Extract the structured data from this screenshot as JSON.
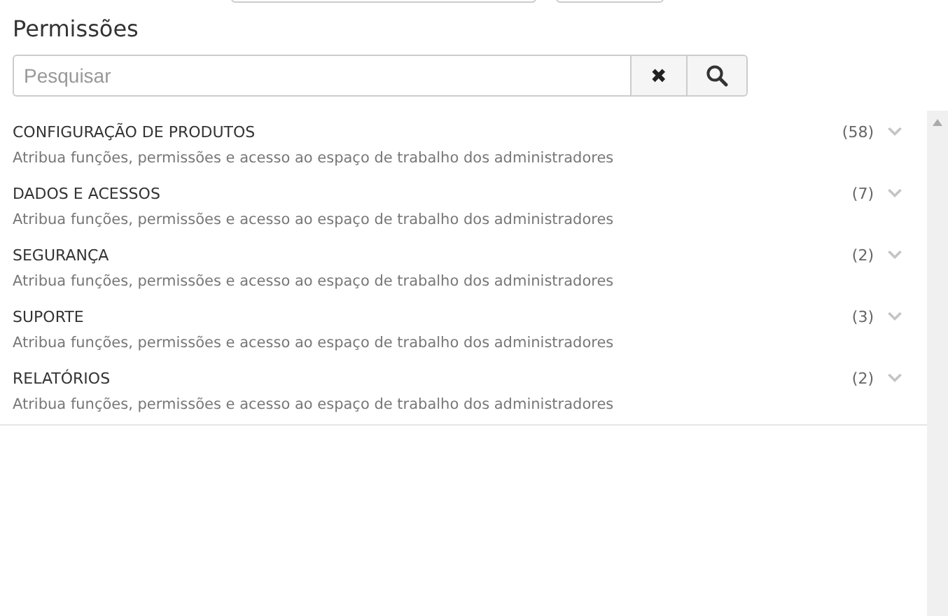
{
  "title": "Permissões",
  "search": {
    "placeholder": "Pesquisar",
    "clear_icon": "✖"
  },
  "items": [
    {
      "name": "CONFIGURAÇÃO DE PRODUTOS",
      "count": "(58)",
      "description": "Atribua funções, permissões e acesso ao espaço de trabalho dos administradores",
      "expanded": false
    },
    {
      "name": "DADOS E ACESSOS",
      "count": "(7)",
      "description": "Atribua funções, permissões e acesso ao espaço de trabalho dos administradores",
      "expanded": false
    },
    {
      "name": "SEGURANÇA",
      "count": "(2)",
      "description": "Atribua funções, permissões e acesso ao espaço de trabalho dos administradores",
      "expanded": false
    },
    {
      "name": "SUPORTE",
      "count": "(3)",
      "description": "Atribua funções, permissões e acesso ao espaço de trabalho dos administradores",
      "expanded": false
    },
    {
      "name": "RELATÓRIOS",
      "count": "(2)",
      "description": "Atribua funções, permissões e acesso ao espaço de trabalho dos administradores",
      "expanded": false
    }
  ]
}
